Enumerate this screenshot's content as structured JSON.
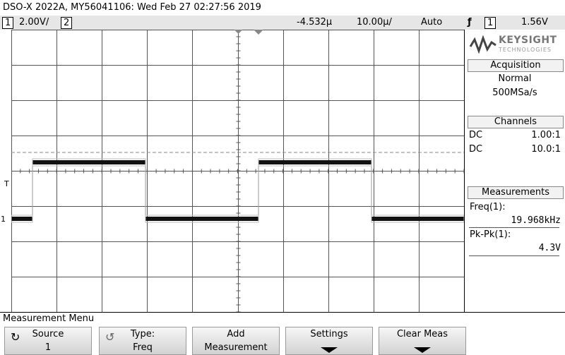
{
  "title": "DSO-X 2022A, MY56041106: Wed Feb 27 02:27:56 2019",
  "status": {
    "ch1_num": "1",
    "ch1_scale": "2.00V/",
    "ch2_num": "2",
    "time_offset": "-4.532µ",
    "time_scale": "10.00µ/",
    "trigger_mode": "Auto",
    "trigger_source": "1",
    "trigger_level": "1.56V"
  },
  "logo": {
    "brand": "KEYSIGHT",
    "sub": "TECHNOLOGIES"
  },
  "acquisition": {
    "header": "Acquisition",
    "mode": "Normal",
    "rate": "500MSa/s"
  },
  "channels": {
    "header": "Channels",
    "rows": [
      {
        "coupling": "DC",
        "probe": "1.00:1"
      },
      {
        "coupling": "DC",
        "probe": "10.0:1"
      }
    ]
  },
  "measurements": {
    "header": "Measurements",
    "items": [
      {
        "label": "Freq(1):",
        "value": "19.968kHz"
      },
      {
        "label": "Pk-Pk(1):",
        "value": "4.3V"
      }
    ]
  },
  "markers": {
    "trigger": "T",
    "channel": "1"
  },
  "menu_title": "Measurement Menu",
  "softkeys": [
    {
      "line1": "Source",
      "line2": "1"
    },
    {
      "line1": "Type:",
      "line2": "Freq"
    },
    {
      "line1": "Add",
      "line2": "Measurement"
    },
    {
      "line1": "Settings",
      "line2": ""
    },
    {
      "line1": "Clear Meas",
      "line2": ""
    }
  ],
  "waveform": {
    "duty_cycle": 0.5,
    "periods_shown": 2
  }
}
